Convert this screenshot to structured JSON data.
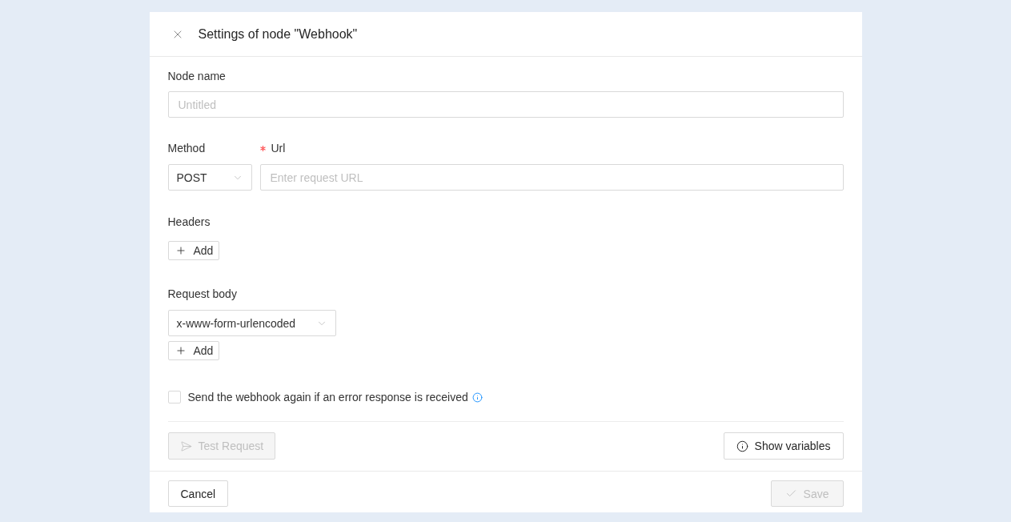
{
  "dialog": {
    "title": "Settings of node \"Webhook\""
  },
  "node_name": {
    "label": "Node name",
    "placeholder": "Untitled"
  },
  "method": {
    "label": "Method",
    "value": "POST"
  },
  "url": {
    "label": "Url",
    "required": true,
    "placeholder": "Enter request URL"
  },
  "headers": {
    "label": "Headers",
    "add_button": "Add"
  },
  "request_body": {
    "label": "Request body",
    "value": "x-www-form-urlencoded",
    "add_button": "Add"
  },
  "retry": {
    "label": "Send the webhook again if an error response is received",
    "checked": false
  },
  "actions": {
    "test_button": {
      "label": "Test Request",
      "disabled": true
    },
    "variables_button": {
      "label": "Show variables",
      "disabled": false
    }
  },
  "footer": {
    "cancel_button": {
      "label": "Cancel",
      "disabled": false
    },
    "save_button": {
      "label": "Save",
      "disabled": true
    }
  }
}
